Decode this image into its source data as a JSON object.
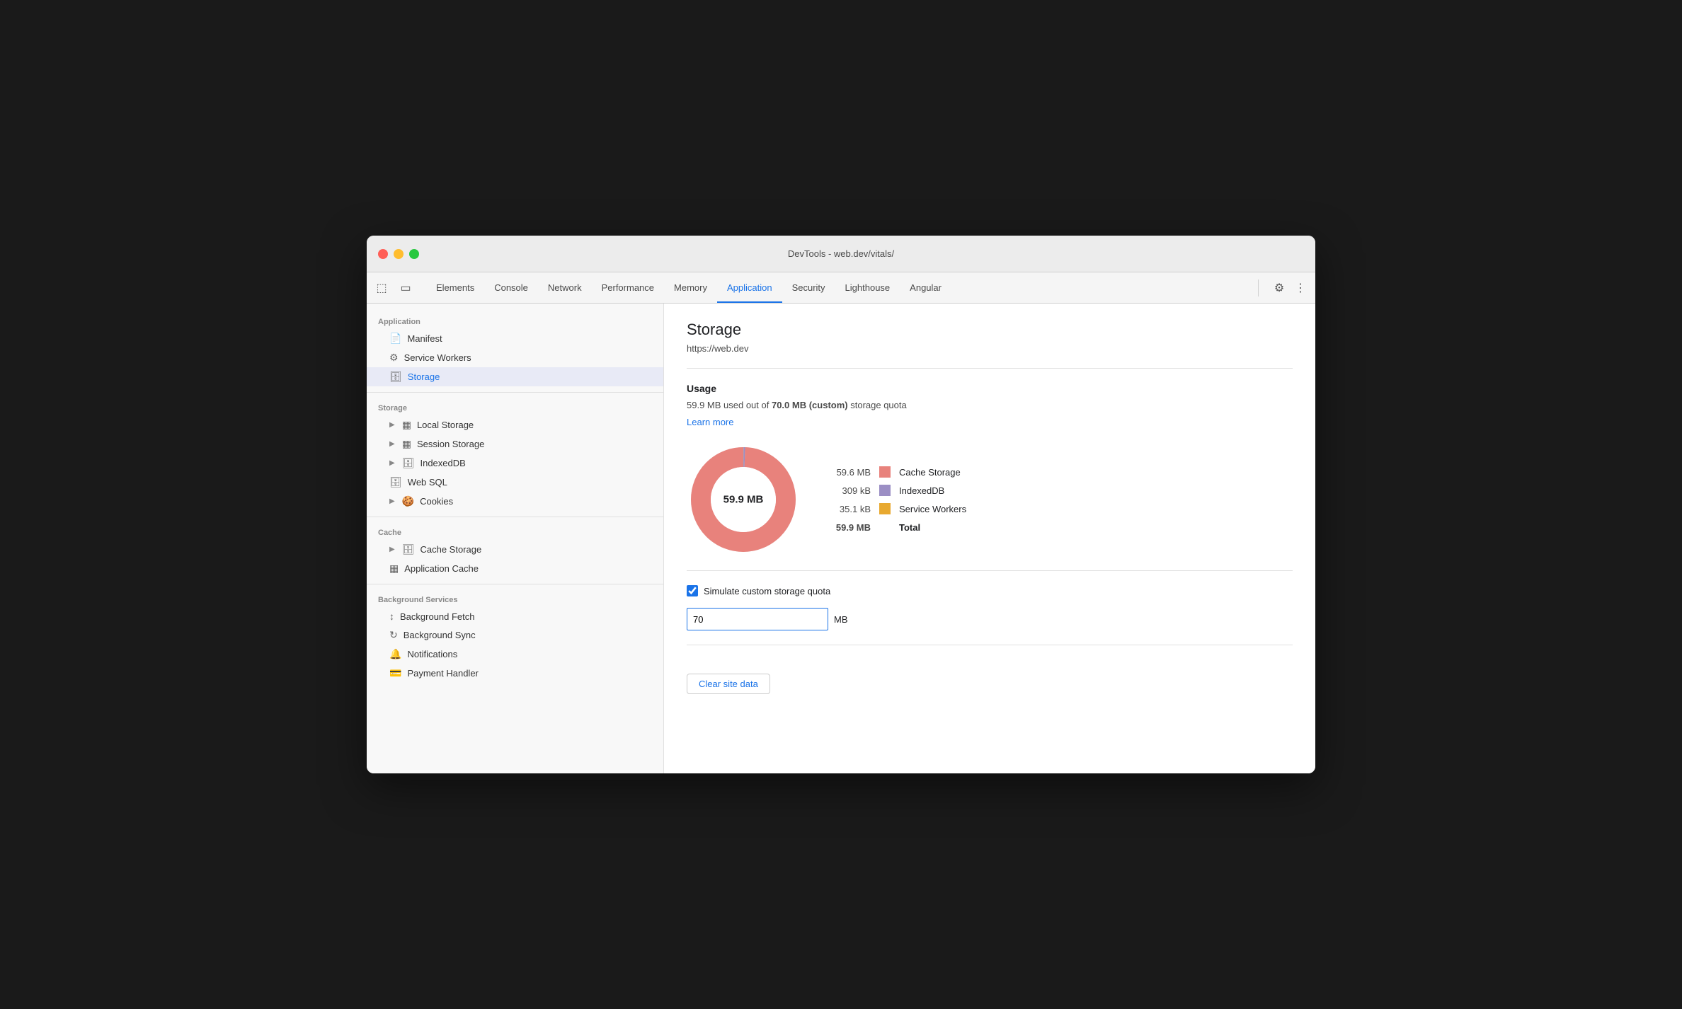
{
  "window": {
    "title": "DevTools - web.dev/vitals/"
  },
  "tabs": [
    {
      "id": "elements",
      "label": "Elements",
      "active": false
    },
    {
      "id": "console",
      "label": "Console",
      "active": false
    },
    {
      "id": "network",
      "label": "Network",
      "active": false
    },
    {
      "id": "performance",
      "label": "Performance",
      "active": false
    },
    {
      "id": "memory",
      "label": "Memory",
      "active": false
    },
    {
      "id": "application",
      "label": "Application",
      "active": true
    },
    {
      "id": "security",
      "label": "Security",
      "active": false
    },
    {
      "id": "lighthouse",
      "label": "Lighthouse",
      "active": false
    },
    {
      "id": "angular",
      "label": "Angular",
      "active": false
    }
  ],
  "sidebar": {
    "application_label": "Application",
    "manifest_label": "Manifest",
    "service_workers_label": "Service Workers",
    "storage_section_label": "Storage",
    "storage_label": "Storage",
    "local_storage_label": "Local Storage",
    "session_storage_label": "Session Storage",
    "indexed_db_label": "IndexedDB",
    "web_sql_label": "Web SQL",
    "cookies_label": "Cookies",
    "cache_section_label": "Cache",
    "cache_storage_label": "Cache Storage",
    "application_cache_label": "Application Cache",
    "background_services_label": "Background Services",
    "background_fetch_label": "Background Fetch",
    "background_sync_label": "Background Sync",
    "notifications_label": "Notifications",
    "payment_handler_label": "Payment Handler"
  },
  "content": {
    "title": "Storage",
    "url": "https://web.dev",
    "usage_title": "Usage",
    "usage_text_pre": "59.9 MB used out of ",
    "usage_bold": "70.0 MB (custom)",
    "usage_text_post": " storage quota",
    "learn_more": "Learn more",
    "chart_center": "59.9 MB",
    "legend": [
      {
        "value": "59.6 MB",
        "color": "#e8827c",
        "label": "Cache Storage"
      },
      {
        "value": "309 kB",
        "color": "#9b8ec4",
        "label": "IndexedDB"
      },
      {
        "value": "35.1 kB",
        "color": "#e8a930",
        "label": "Service Workers"
      },
      {
        "value": "59.9 MB",
        "color": "",
        "label": "Total",
        "bold": true
      }
    ],
    "simulate_label": "Simulate custom storage quota",
    "quota_value": "70",
    "mb_label": "MB",
    "clear_button": "Clear site data"
  }
}
